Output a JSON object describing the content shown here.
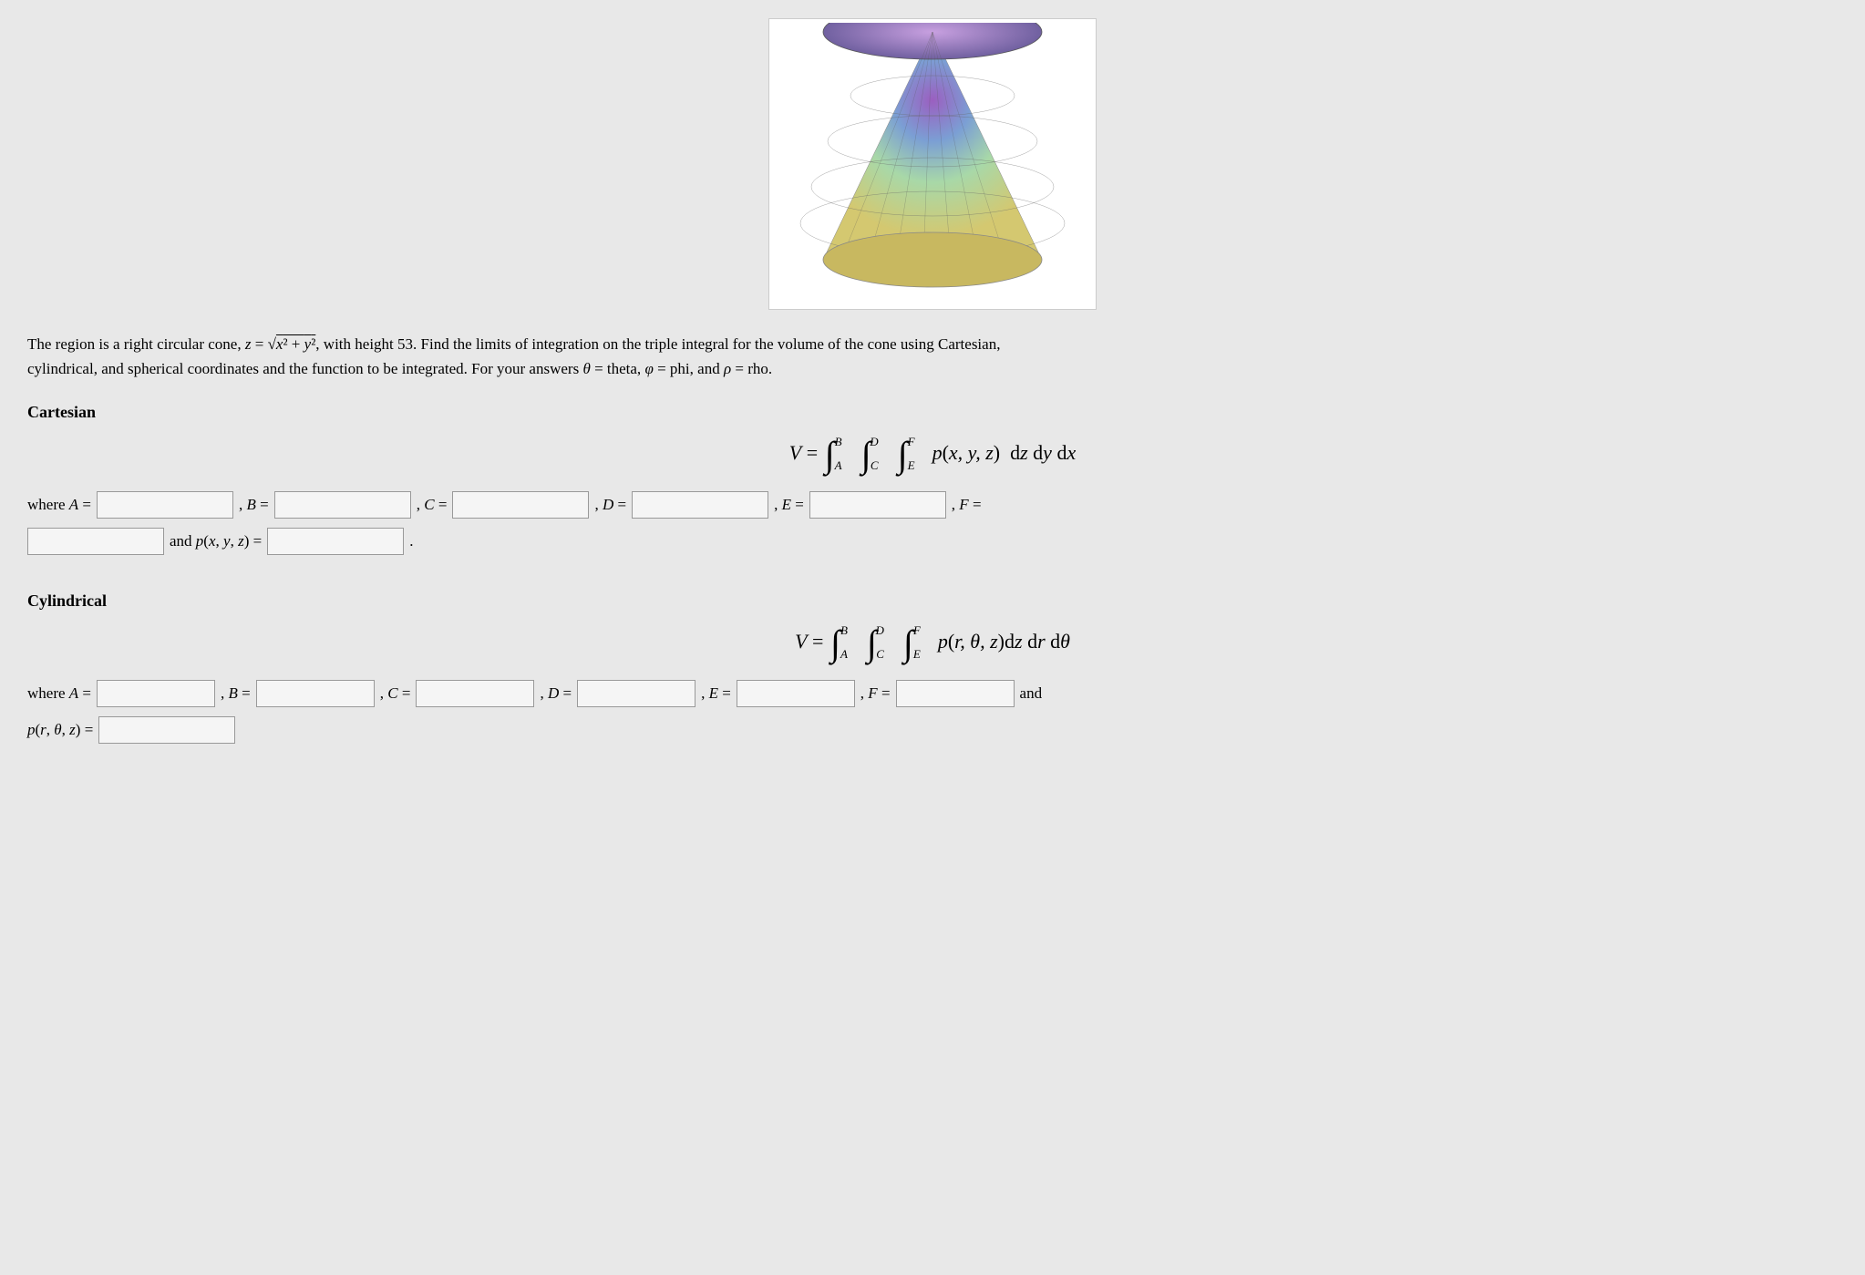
{
  "page": {
    "cone_alt": "3D cone visualization",
    "description": "The region is a right circular cone, z = √(x² + y²), with height 53. Find the limits of integration on the triple integral for the volume of the cone using Cartesian, cylindrical, and spherical coordinates and the function to be integrated. For your answers θ = theta, φ = phi, and ρ = rho.",
    "cartesian": {
      "title": "Cartesian",
      "formula_parts": {
        "V_equals": "V =",
        "integral_notation": "∫∫∫ p(x, y, z) dz dy dx",
        "limits": "A, B, C, D, E, F"
      },
      "where_label": "where A =",
      "B_label": ", B =",
      "C_label": ", C =",
      "D_label": ", D =",
      "E_label": ", E =",
      "F_label": ", F =",
      "and_p_label": "and p(x, y, z) ="
    },
    "cylindrical": {
      "title": "Cylindrical",
      "formula_parts": {
        "V_equals": "V =",
        "integral_notation": "∫∫∫ p(r, θ, z) dz dr dθ"
      },
      "where_label": "where A =",
      "B_label": ", B =",
      "C_label": ", C =",
      "D_label": ", D =",
      "E_label": ", E =",
      "F_label": ", F =",
      "and_label": "and",
      "p_label": "p(r, θ, z) ="
    }
  }
}
